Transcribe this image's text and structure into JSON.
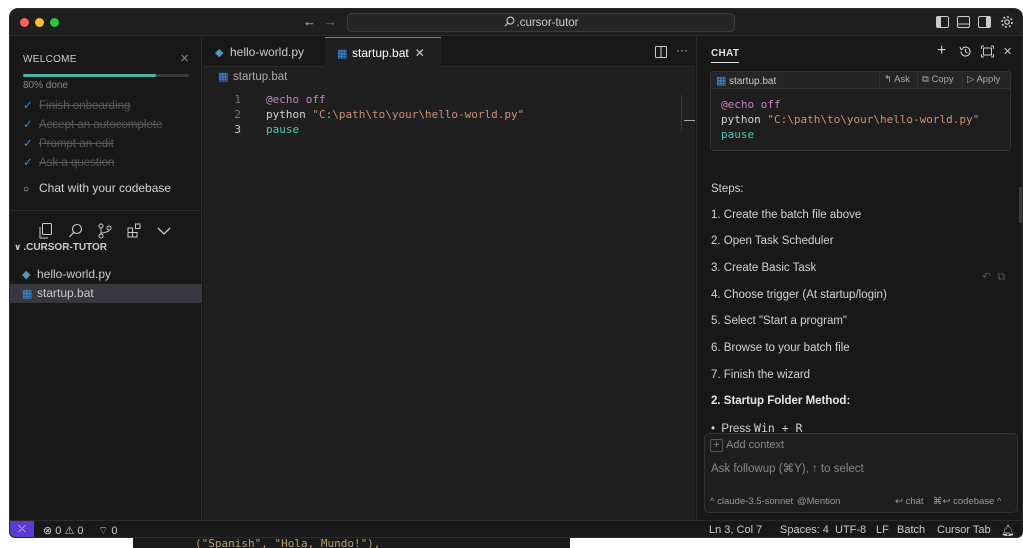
{
  "background": {
    "code_peek": "(\"Spanish\", \"Hola, Mundo!\"),"
  },
  "titlebar": {
    "search_text": ".cursor-tutor",
    "nav_back": "←",
    "nav_forward": "→"
  },
  "welcome": {
    "title": "WELCOME",
    "progress_label": "80% done",
    "progress_value": 0.8,
    "done_items": [
      "Finish onboarding",
      "Accept an autocomplete",
      "Prompt an edit",
      "Ask a question"
    ],
    "current_item": "Chat with your codebase"
  },
  "explorer": {
    "root": ".CURSOR-TUTOR",
    "files": [
      "hello-world.py",
      "startup.bat"
    ]
  },
  "editor": {
    "tabs": [
      "hello-world.py",
      "startup.bat"
    ],
    "breadcrumb": "startup.bat",
    "lines": [
      {
        "num": "1",
        "parts": [
          [
            "kw",
            "@echo"
          ],
          [
            "fn",
            " "
          ],
          [
            "kw",
            "off"
          ]
        ]
      },
      {
        "num": "2",
        "parts": [
          [
            "fn",
            "python "
          ],
          [
            "str",
            "\"C:\\path\\to\\your\\hello-world.py\""
          ]
        ]
      },
      {
        "num": "3",
        "parts": [
          [
            "cmd",
            "pause"
          ]
        ]
      }
    ]
  },
  "chat": {
    "title": "CHAT",
    "codeblock": {
      "file": "startup.bat",
      "ask": "Ask",
      "copy": "Copy",
      "apply": "Apply"
    },
    "steps_heading": "Steps:",
    "steps": [
      "1. Create the batch file above",
      "2. Open Task Scheduler",
      "3. Create Basic Task",
      "4. Choose trigger (At startup/login)",
      "5. Select \"Start a program\"",
      "6. Browse to your batch file",
      "7. Finish the wizard"
    ],
    "method_heading": "2. Startup Folder Method:",
    "bullet_prefix": "Press ",
    "bullet_code": "Win + R",
    "input": {
      "add_context": "Add context",
      "placeholder": "Ask followup (⌘Y), ↑ to select",
      "model": "claude-3.5-sonnet",
      "mention": "@Mention",
      "chat_hint": "chat",
      "codebase_hint": "codebase"
    }
  },
  "statusbar": {
    "errors": "0",
    "warnings": "0",
    "ports": "0",
    "position": "Ln 3, Col 7",
    "spaces": "Spaces: 4",
    "encoding": "UTF-8",
    "eol": "LF",
    "language": "Batch",
    "tab_mode": "Cursor Tab"
  },
  "colors": {
    "accent": "#3f8ed6",
    "progress": "#4cb3a7",
    "remote": "#5b3bd1"
  }
}
